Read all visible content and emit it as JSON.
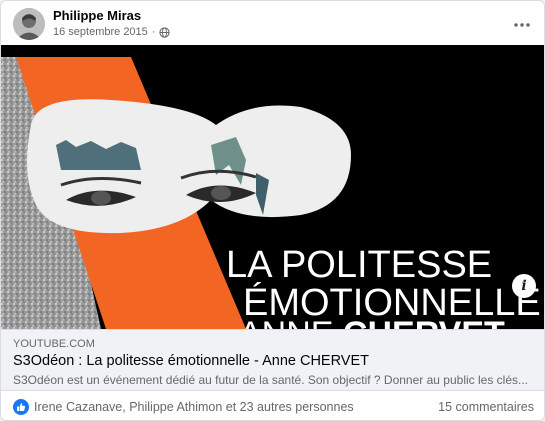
{
  "post": {
    "author": "Philippe Miras",
    "date": "16 septembre 2015",
    "separator": "·",
    "audience_icon": "globe-icon",
    "more_icon": "more-options-icon"
  },
  "link_preview": {
    "image_text": {
      "line1": "LA POLITESSE",
      "line2": "ÉMOTIONNELLE",
      "line3_light": "ANNE ",
      "line3_bold": "CHERVET"
    },
    "info_label": "i",
    "domain": "YOUTUBE.COM",
    "title": "S3Odéon : La politesse émotionnelle - Anne CHERVET",
    "description": "S3Odéon est un événement dédié au futur de la santé. Son objectif ? Donner au public les clés..."
  },
  "reactions": {
    "icon": "like-icon",
    "names": "Irene Cazanave, Philippe Athimon et 23 autres personnes",
    "comments": "15 commentaires"
  },
  "colors": {
    "accent": "#1877f2",
    "orange": "#f26522",
    "secondary_text": "#65676b"
  }
}
